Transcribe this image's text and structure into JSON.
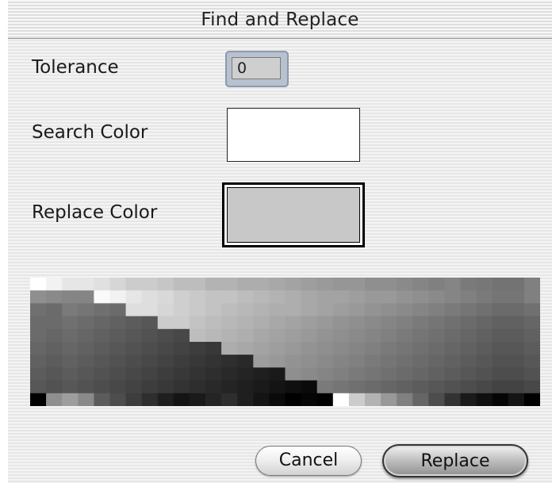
{
  "dialog": {
    "title": "Find and Replace"
  },
  "fields": {
    "tolerance_label": "Tolerance",
    "tolerance_value": "0",
    "search_color_label": "Search Color",
    "search_color": "#ffffff",
    "replace_color_label": "Replace Color",
    "replace_color": "#c8c8c8"
  },
  "buttons": {
    "cancel": "Cancel",
    "replace": "Replace"
  },
  "palette": {
    "description": "grayscale color picker swatch grid",
    "rows": [
      [
        "#ffffff",
        "#f2f2f2",
        "#e6e6e6",
        "#e6e6e6",
        "#e0e0e0",
        "#d6d6d6",
        "#cccccc",
        "#cccccc",
        "#c6c6c6",
        "#bdbdbd",
        "#bdbdbd",
        "#b3b3b3",
        "#b3b3b3",
        "#adadad",
        "#adadad",
        "#a8a8a8",
        "#a3a3a3",
        "#9e9e9e",
        "#9a9a9a",
        "#969696",
        "#969696",
        "#8f8f8f",
        "#8f8f8f",
        "#8a8a8a",
        "#858585",
        "#808080",
        "#858585",
        "#7a7a7a",
        "#777777",
        "#737373",
        "#737373",
        "#808080"
      ],
      [
        "#8f8f8f",
        "#8a8a8a",
        "#858585",
        "#858585",
        "#fafafa",
        "#f2f2f2",
        "#e6e6e6",
        "#dedede",
        "#d9d9d9",
        "#cfcfcf",
        "#c9c9c9",
        "#c3c3c3",
        "#c3c3c3",
        "#bdbdbd",
        "#b8b8b8",
        "#b3b3b3",
        "#aeaeae",
        "#a8a8a8",
        "#a3a3a3",
        "#a3a3a3",
        "#9e9e9e",
        "#999999",
        "#999999",
        "#939393",
        "#8f8f8f",
        "#8a8a8a",
        "#858585",
        "#808080",
        "#7a7a7a",
        "#757575",
        "#757575",
        "#808080"
      ],
      [
        "#707070",
        "#6b6b6b",
        "#7a7a7a",
        "#757575",
        "#707070",
        "#6b6b6b",
        "#dedede",
        "#dedede",
        "#d6d6d6",
        "#cfcfcf",
        "#c9c9c9",
        "#c3c3c3",
        "#bdbdbd",
        "#b8b8b8",
        "#b3b3b3",
        "#aeaeae",
        "#aeaeae",
        "#a8a8a8",
        "#a3a3a3",
        "#9e9e9e",
        "#999999",
        "#939393",
        "#8f8f8f",
        "#8a8a8a",
        "#858585",
        "#808080",
        "#7a7a7a",
        "#757575",
        "#707070",
        "#6b6b6b",
        "#6b6b6b",
        "#707070"
      ],
      [
        "#6b6b6b",
        "#6b6b6b",
        "#707070",
        "#6b6b6b",
        "#666666",
        "#616161",
        "#5c5c5c",
        "#575757",
        "#cccccc",
        "#cccccc",
        "#c3c3c3",
        "#bdbdbd",
        "#b8b8b8",
        "#b3b3b3",
        "#aeaeae",
        "#a8a8a8",
        "#a3a3a3",
        "#9e9e9e",
        "#999999",
        "#939393",
        "#8f8f8f",
        "#8a8a8a",
        "#858585",
        "#808080",
        "#7a7a7a",
        "#757575",
        "#707070",
        "#6b6b6b",
        "#666666",
        "#616161",
        "#616161",
        "#666666"
      ],
      [
        "#6b6b6b",
        "#666666",
        "#6b6b6b",
        "#666666",
        "#616161",
        "#5c5c5c",
        "#575757",
        "#525252",
        "#4d4d4d",
        "#484848",
        "#bdbdbd",
        "#b8b8b8",
        "#b3b3b3",
        "#aeaeae",
        "#a8a8a8",
        "#a3a3a3",
        "#9e9e9e",
        "#999999",
        "#939393",
        "#8f8f8f",
        "#8a8a8a",
        "#858585",
        "#808080",
        "#7a7a7a",
        "#757575",
        "#707070",
        "#6b6b6b",
        "#666666",
        "#616161",
        "#5c5c5c",
        "#5c5c5c",
        "#616161"
      ],
      [
        "#666666",
        "#616161",
        "#666666",
        "#616161",
        "#5c5c5c",
        "#575757",
        "#525252",
        "#4d4d4d",
        "#484848",
        "#434343",
        "#3d3d3d",
        "#383838",
        "#adadad",
        "#a8a8a8",
        "#a3a3a3",
        "#9e9e9e",
        "#999999",
        "#939393",
        "#8f8f8f",
        "#8a8a8a",
        "#858585",
        "#808080",
        "#7a7a7a",
        "#757575",
        "#707070",
        "#6b6b6b",
        "#666666",
        "#616161",
        "#5c5c5c",
        "#575757",
        "#575757",
        "#5c5c5c"
      ],
      [
        "#616161",
        "#5c5c5c",
        "#616161",
        "#5c5c5c",
        "#575757",
        "#525252",
        "#4d4d4d",
        "#484848",
        "#434343",
        "#3d3d3d",
        "#383838",
        "#333333",
        "#2e2e2e",
        "#292929",
        "#9e9e9e",
        "#999999",
        "#939393",
        "#8f8f8f",
        "#8a8a8a",
        "#858585",
        "#808080",
        "#7a7a7a",
        "#757575",
        "#707070",
        "#6b6b6b",
        "#666666",
        "#616161",
        "#5c5c5c",
        "#575757",
        "#525252",
        "#525252",
        "#575757"
      ],
      [
        "#5c5c5c",
        "#575757",
        "#5c5c5c",
        "#575757",
        "#525252",
        "#4d4d4d",
        "#484848",
        "#434343",
        "#3d3d3d",
        "#383838",
        "#333333",
        "#2e2e2e",
        "#292929",
        "#242424",
        "#1f1f1f",
        "#1a1a1a",
        "#8f8f8f",
        "#8a8a8a",
        "#858585",
        "#808080",
        "#7a7a7a",
        "#757575",
        "#707070",
        "#6b6b6b",
        "#666666",
        "#616161",
        "#5c5c5c",
        "#575757",
        "#525252",
        "#4d4d4d",
        "#4d4d4d",
        "#525252"
      ],
      [
        "#575757",
        "#525252",
        "#575757",
        "#525252",
        "#4d4d4d",
        "#484848",
        "#434343",
        "#3d3d3d",
        "#383838",
        "#333333",
        "#2e2e2e",
        "#292929",
        "#242424",
        "#1f1f1f",
        "#1a1a1a",
        "#141414",
        "#0f0f0f",
        "#0a0a0a",
        "#7a7a7a",
        "#757575",
        "#707070",
        "#6b6b6b",
        "#666666",
        "#616161",
        "#5c5c5c",
        "#575757",
        "#525252",
        "#4d4d4d",
        "#484848",
        "#434343",
        "#434343",
        "#484848"
      ],
      [
        "#000000",
        "#8f8f8f",
        "#9e9e9e",
        "#8a8a8a",
        "#5c5c5c",
        "#4d4d4d",
        "#3d3d3d",
        "#2e2e2e",
        "#1f1f1f",
        "#141414",
        "#1a1a1a",
        "#242424",
        "#2e2e2e",
        "#1f1f1f",
        "#141414",
        "#0a0a0a",
        "#000000",
        "#050505",
        "#000000",
        "#ffffff",
        "#cccccc",
        "#b3b3b3",
        "#999999",
        "#808080",
        "#666666",
        "#4d4d4d",
        "#333333",
        "#1a1a1a",
        "#0f0f0f",
        "#050505",
        "#141414",
        "#000000"
      ]
    ]
  }
}
